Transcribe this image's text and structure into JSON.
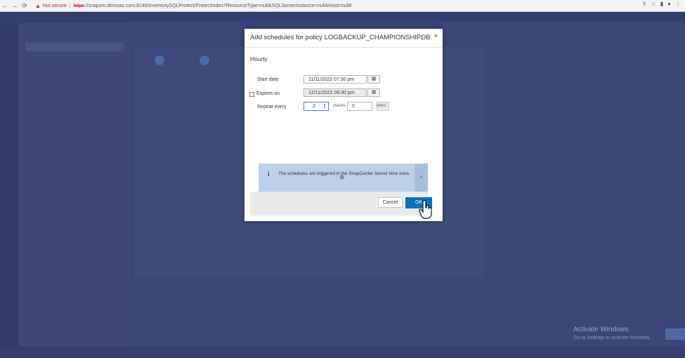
{
  "browser": {
    "security_label": "Not secure",
    "url_proto": "https",
    "url_rest": "://snapvm.demoaz.com:8146/InventorySQLProtect/ProtectIndex?ResourceType=null&SQLServerInstance=null&Host=null#"
  },
  "modal": {
    "title": "Add schedules for policy LOGBACKUP_CHAMPIONSHIPDB",
    "close_glyph": "×",
    "section": "Hourly",
    "start_date_label": "Start date",
    "start_date_value": "11/11/2022 07:30 pm",
    "expires_label": "Expires on",
    "expires_value": "12/11/2022 06:30 pm",
    "repeat_label": "Repeat every",
    "hours_value": "2",
    "hours_unit": "hours",
    "mins_value": "0",
    "mins_unit": "mins",
    "info_text": "The schedules are triggered in the SnapCenter Server time zone.",
    "info_close": "×",
    "cancel_label": "Cancel",
    "ok_label": "OK"
  },
  "watermark": {
    "title": "Activate Windows",
    "subtitle": "Go to Settings to activate Windows."
  }
}
